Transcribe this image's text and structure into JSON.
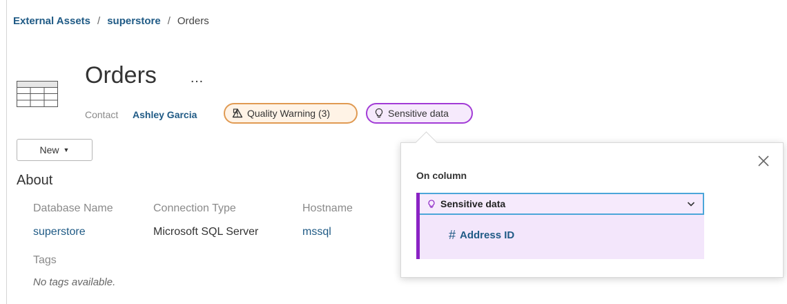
{
  "breadcrumb": {
    "items": [
      {
        "label": "External Assets"
      },
      {
        "label": "superstore"
      },
      {
        "label": "Orders"
      }
    ],
    "separator": "/"
  },
  "asset": {
    "title": "Orders",
    "more_label": "…",
    "contact_label": "Contact",
    "contact_name": "Ashley Garcia"
  },
  "badges": {
    "quality_warning": {
      "label": "Quality Warning (3)",
      "border": "#e09a52",
      "background": "#fff3e6"
    },
    "sensitive": {
      "label": "Sensitive data",
      "border": "#a23bd6",
      "background": "#f6eafc"
    }
  },
  "new_button": {
    "label": "New",
    "icon": "caret-down-icon"
  },
  "about": {
    "heading": "About",
    "columns": [
      {
        "header": "Database Name",
        "value": "superstore"
      },
      {
        "header": "Connection Type",
        "value": "Microsoft SQL Server"
      },
      {
        "header": "Hostname",
        "value": "mssql"
      }
    ],
    "tags_label": "Tags",
    "tags_empty": "No tags available."
  },
  "popover": {
    "on_column_label": "On column",
    "selected": "Sensitive data",
    "columns": [
      {
        "label": "Address ID",
        "icon": "hash-icon"
      }
    ],
    "accent": "#8a22c4",
    "focus": "#4ba6d9"
  },
  "colors": {
    "link": "#1f5a85"
  }
}
